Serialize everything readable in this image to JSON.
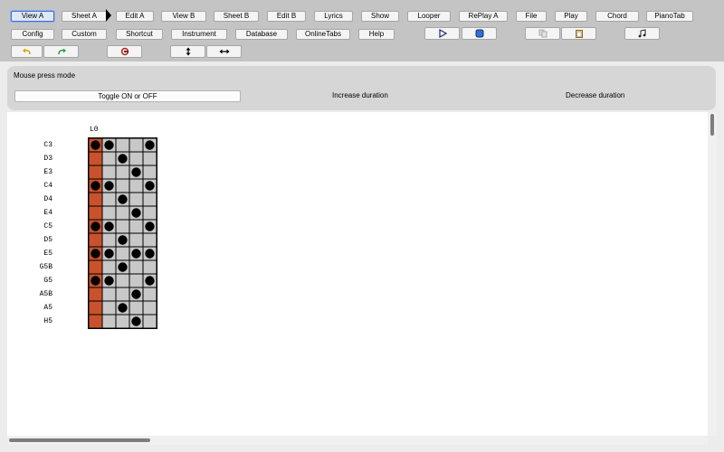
{
  "toolbar": {
    "row1": [
      "View A",
      "Sheet A",
      "Edit A",
      "View B",
      "Sheet B",
      "Edit B",
      "Lyrics",
      "Show",
      "Looper",
      "RePlay A",
      "File",
      "Play",
      "Chord",
      "PianoTab"
    ],
    "row2": [
      "Config",
      "Custom",
      "Shortcut",
      "Instrument",
      "Database",
      "OnlineTabs",
      "Help"
    ],
    "active": "View A"
  },
  "mouse_panel": {
    "title": "Mouse press mode",
    "options": [
      "Toggle ON or OFF",
      "Increase duration",
      "Decrease duration"
    ]
  },
  "sequencer": {
    "column_label": "L0",
    "notes": [
      "C3",
      "D3",
      "E3",
      "C4",
      "D4",
      "E4",
      "C5",
      "D5",
      "E5",
      "G5B",
      "G5",
      "A5B",
      "A5",
      "H5"
    ],
    "pattern": [
      [
        1,
        1,
        0,
        0,
        1
      ],
      [
        0,
        0,
        1,
        0,
        0
      ],
      [
        0,
        0,
        0,
        1,
        0
      ],
      [
        1,
        1,
        0,
        0,
        1
      ],
      [
        0,
        0,
        1,
        0,
        0
      ],
      [
        0,
        0,
        0,
        1,
        0
      ],
      [
        1,
        1,
        0,
        0,
        1
      ],
      [
        0,
        0,
        1,
        0,
        0
      ],
      [
        1,
        1,
        0,
        1,
        1
      ],
      [
        0,
        0,
        1,
        0,
        0
      ],
      [
        1,
        1,
        0,
        0,
        1
      ],
      [
        0,
        0,
        0,
        1,
        0
      ],
      [
        0,
        0,
        1,
        0,
        0
      ],
      [
        0,
        0,
        0,
        1,
        0
      ]
    ],
    "colors": {
      "first_column": "#c9522c",
      "cell": "#c8c8c8",
      "dot": "#000000",
      "border": "#000000"
    }
  }
}
